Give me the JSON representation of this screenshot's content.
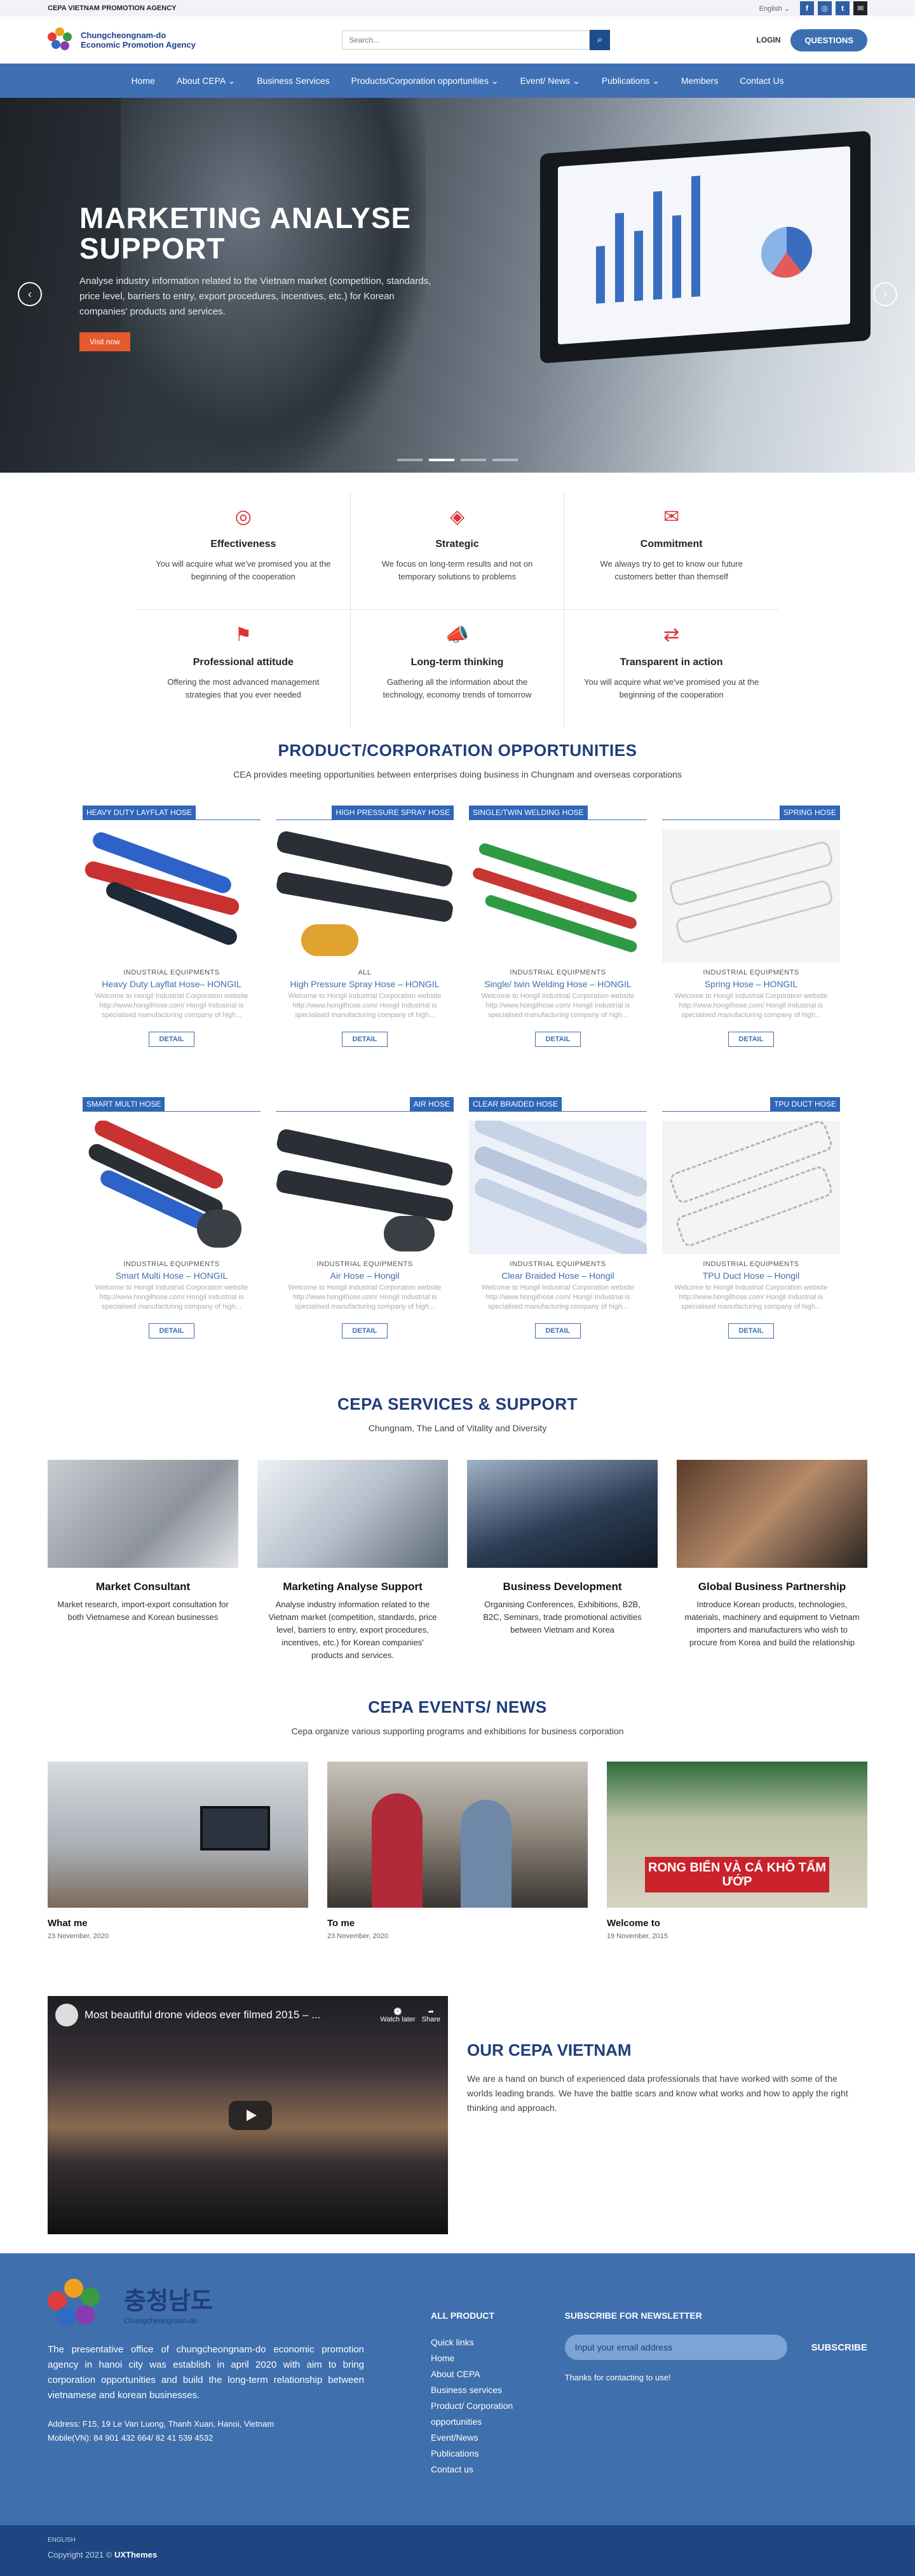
{
  "topbar": {
    "agency": "CEPA VIETNAM PROMOTION AGENCY",
    "language": "English ⌄",
    "social": [
      "f",
      "◎",
      "t",
      "✉"
    ]
  },
  "header": {
    "logo_line1": "Chungcheongnam-do",
    "logo_line2": "Economic Promotion Agency",
    "search_placeholder": "Search...",
    "login": "LOGIN",
    "questions": "QUESTIONS"
  },
  "nav": [
    "Home",
    "About CEPA ⌄",
    "Business Services",
    "Products/Corporation opportunities ⌄",
    "Event/ News ⌄",
    "Publications ⌄",
    "Members",
    "Contact Us"
  ],
  "hero": {
    "title": "MARKETING ANALYSE SUPPORT",
    "text": "Analyse industry information related to the Vietnam market (competition, standards, price level, barriers to entry, export procedures, incentives, etc.) for Korean companies' products and services.",
    "button": "Visit now",
    "prev": "‹",
    "next": "›"
  },
  "features": [
    {
      "icon": "◎",
      "title": "Effectiveness",
      "text": "You will acquire what we've promised you at the beginning of the cooperation"
    },
    {
      "icon": "◈",
      "title": "Strategic",
      "text": "We focus on long-term results and not on temporary solutions to problems"
    },
    {
      "icon": "✉",
      "title": "Commitment",
      "text": "We always try to get to know our future customers better than themself"
    },
    {
      "icon": "⚑",
      "title": "Professional attitude",
      "text": "Offering the most advanced management strategies that you ever needed"
    },
    {
      "icon": "📣",
      "title": "Long-term thinking",
      "text": "Gathering all the information about the technology, economy trends of tomorrow"
    },
    {
      "icon": "⇄",
      "title": "Transparent in action",
      "text": "You will acquire what we've promised you at the beginning of the cooperation"
    }
  ],
  "products_section": {
    "title": "PRODUCT/CORPORATION OPPORTUNITIES",
    "subtitle": "CEA provides meeting opportunities between enterprises doing business in Chungnam and overseas corporations"
  },
  "products": [
    {
      "tag": "HEAVY DUTY LAYFLAT HOSE",
      "category": "INDUSTRIAL EQUIPMENTS",
      "name": "Heavy Duty Layflat Hose– HONGIL",
      "desc": "Welcome to Hongil Industrial Corporation website http://www.hongilhose.com/ Hongil Industrial is specialised manufacturing company of high...",
      "detail": "DETAIL"
    },
    {
      "tag": "HIGH PRESSURE SPRAY HOSE",
      "category": "ALL",
      "name": "High Pressure Spray Hose – HONGIL",
      "desc": "Welcome to Hongil Industrial Corporation website http://www.hongilhose.com/ Hongil Industrial is specialised manufacturing company of high...",
      "detail": "DETAIL"
    },
    {
      "tag": "SINGLE/TWIN WELDING HOSE",
      "category": "INDUSTRIAL EQUIPMENTS",
      "name": "Single/ twin Welding Hose – HONGIL",
      "desc": "Welcome to Hongil Industrial Corporation website http://www.hongilhose.com/ Hongil Industrial is specialised manufacturing company of high...",
      "detail": "DETAIL"
    },
    {
      "tag": "SPRING HOSE",
      "category": "INDUSTRIAL EQUIPMENTS",
      "name": "Spring Hose – HONGIL",
      "desc": "Welcome to Hongil Industrial Corporation website http://www.hongilhose.com/ Hongil Industrial is specialised manufacturing company of high...",
      "detail": "DETAIL"
    },
    {
      "tag": "SMART MULTI HOSE",
      "category": "INDUSTRIAL EQUIPMENTS",
      "name": "Smart Multi Hose – HONGIL",
      "desc": "Welcome to Hongil Industrial Corporation website http://www.hongilhose.com/ Hongil Industrial is specialised manufacturing company of high...",
      "detail": "DETAIL"
    },
    {
      "tag": "AIR HOSE",
      "category": "INDUSTRIAL EQUIPMENTS",
      "name": "Air Hose – Hongil",
      "desc": "Welcome to Hongil Industrial Corporation website http://www.hongilhose.com/ Hongil Industrial is specialised manufacturing company of high...",
      "detail": "DETAIL"
    },
    {
      "tag": "CLEAR BRAIDED HOSE",
      "category": "INDUSTRIAL EQUIPMENTS",
      "name": "Clear Braided Hose – Hongil",
      "desc": "Welcome to Hongil Industrial Corporation website http://www.hongilhose.com/ Hongil Industrial is specialised manufacturing company of high...",
      "detail": "DETAIL"
    },
    {
      "tag": "TPU DUCT HOSE",
      "category": "INDUSTRIAL EQUIPMENTS",
      "name": "TPU Duct Hose – Hongil",
      "desc": "Welcome to Hongil Industrial Corporation website http://www.hongilhose.com/ Hongil Industrial is specialised manufacturing company of high...",
      "detail": "DETAIL"
    }
  ],
  "services_section": {
    "title": "CEPA SERVICES & SUPPORT",
    "subtitle": "Chungnam, The Land of Vitality and Diversity"
  },
  "services": [
    {
      "title": "Market Consultant",
      "text": "Market research, import-export consultation for both Vietnamese and Korean businesses"
    },
    {
      "title": "Marketing Analyse Support",
      "text": "Analyse industry information related to the Vietnam market (competition, standards, price level, barriers to entry, export procedures, incentives, etc.) for Korean companies' products and services."
    },
    {
      "title": "Business Development",
      "text": "Organising Conferences, Exhibitions, B2B, B2C, Seminars, trade promotional activities between Vietnam and Korea"
    },
    {
      "title": "Global Business Partnership",
      "text": "Introduce Korean products, technologies, materials, machinery and equipment to Vietnam importers and manufacturers who wish to procure from Korea and build the relationship"
    }
  ],
  "news_section": {
    "title": "CEPA EVENTS/ NEWS",
    "subtitle": "Cepa organize various supporting programs and exhibitions for business corporation"
  },
  "news": [
    {
      "title": "What me",
      "date": "23 November, 2020"
    },
    {
      "title": "To me",
      "date": "23 November, 2020"
    },
    {
      "title": "Welcome to",
      "date": "19 November, 2015",
      "banner": "RONG BIỂN VÀ CÁ KHÔ TẨM ƯỚP"
    }
  ],
  "video": {
    "caption": "Most beautiful drone videos ever filmed 2015 – ...",
    "watch_later": "Watch later",
    "share": "Share",
    "heading": "OUR CEPA VIETNAM",
    "text": "We are a hand on bunch of experienced data professionals that have worked with some of the worlds leading brands. We have the battle scars and know what works and how to apply the right thinking and approach."
  },
  "footer": {
    "korean": "충청남도",
    "logo_sub": "Chungcheongnam-do",
    "about": "The presentative office of chungcheongnam-do economic promotion agency in hanoi city was establish in april 2020 with aim to bring corporation opportunities and build the long-term relationship between vietnamese and korean businesses.",
    "address": "Address: F15, 19 Le Van Luong, Thanh Xuan, Hanoi, Vietnam",
    "mobile": "Mobile(VN): 84 901 432 664/ 82 41 539 4532",
    "links_title": "ALL PRODUCT",
    "links": [
      "Quick links",
      "Home",
      "About CEPA",
      "Business services",
      "Product/ Corporation",
      "opportunities",
      "Event/News",
      "Publications",
      "Contact us"
    ],
    "newsletter_title": "SUBSCRIBE FOR NEWSLETTER",
    "email_placeholder": "Input your email address",
    "subscribe": "SUBSCRIBE",
    "thanks": "Thanks for contacting to use!",
    "lang": "ENGLISH",
    "copyright": "Copyright 2021 ©",
    "brand": "UXThemes"
  },
  "colors": {
    "brand_blue": "#3f70b4",
    "title_navy": "#1f3d7a",
    "accent_orange": "#e4592e",
    "icon_red": "#d33333"
  }
}
